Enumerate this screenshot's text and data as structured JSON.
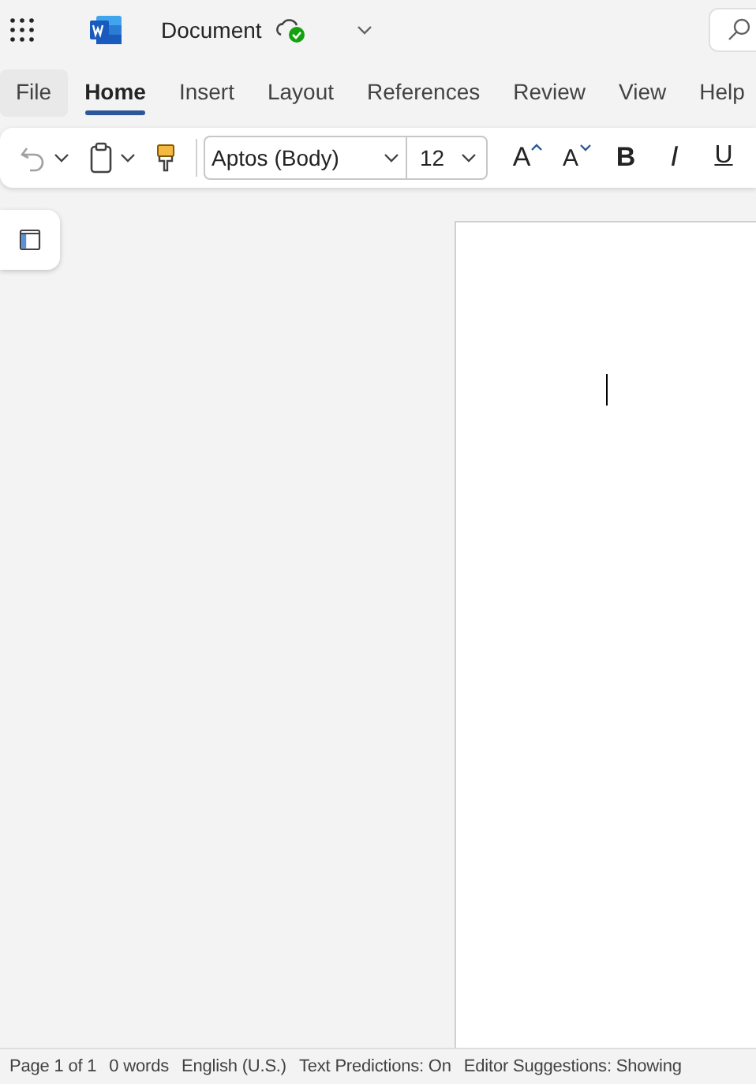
{
  "title_bar": {
    "document_title": "Document",
    "saved": true
  },
  "tabs": [
    {
      "label": "File",
      "selected": false,
      "kind": "file"
    },
    {
      "label": "Home",
      "selected": true,
      "kind": "tab"
    },
    {
      "label": "Insert",
      "selected": false,
      "kind": "tab"
    },
    {
      "label": "Layout",
      "selected": false,
      "kind": "tab"
    },
    {
      "label": "References",
      "selected": false,
      "kind": "tab"
    },
    {
      "label": "Review",
      "selected": false,
      "kind": "tab"
    },
    {
      "label": "View",
      "selected": false,
      "kind": "tab"
    },
    {
      "label": "Help",
      "selected": false,
      "kind": "tab"
    }
  ],
  "toolbar": {
    "font": "Aptos (Body)",
    "size": "12",
    "format_buttons": [
      {
        "glyph": "A",
        "kind": "grow"
      },
      {
        "glyph": "A",
        "kind": "shrink"
      },
      {
        "glyph": "B",
        "kind": "bold"
      },
      {
        "glyph": "I",
        "kind": "italic"
      },
      {
        "glyph": "U",
        "kind": "underline"
      }
    ]
  },
  "status_bar": [
    "Page 1 of 1",
    "0 words",
    "English (U.S.)",
    "Text Predictions: On",
    "Editor Suggestions: Showing"
  ]
}
